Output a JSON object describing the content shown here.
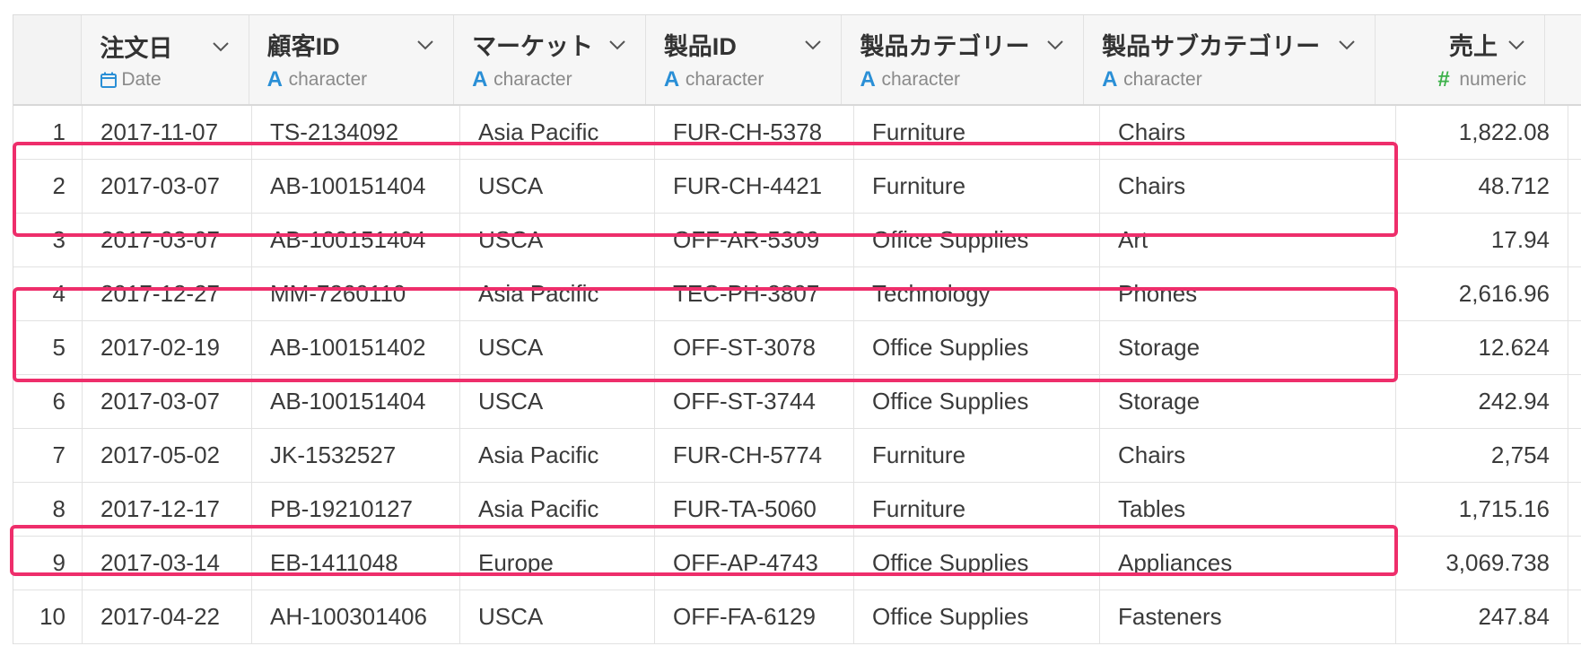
{
  "columns": [
    {
      "name": "注文日",
      "type": "Date",
      "type_icon": "calendar-icon"
    },
    {
      "name": "顧客ID",
      "type": "character",
      "type_icon": "A"
    },
    {
      "name": "マーケット",
      "type": "character",
      "type_icon": "A"
    },
    {
      "name": "製品ID",
      "type": "character",
      "type_icon": "A"
    },
    {
      "name": "製品カテゴリー",
      "type": "character",
      "type_icon": "A"
    },
    {
      "name": "製品サブカテゴリー",
      "type": "character",
      "type_icon": "A"
    },
    {
      "name": "売上",
      "type": "numeric",
      "type_icon": "#"
    }
  ],
  "rows": [
    [
      "1",
      "2017-11-07",
      "TS-2134092",
      "Asia Pacific",
      "FUR-CH-5378",
      "Furniture",
      "Chairs",
      "1,822.08"
    ],
    [
      "2",
      "2017-03-07",
      "AB-100151404",
      "USCA",
      "FUR-CH-4421",
      "Furniture",
      "Chairs",
      "48.712"
    ],
    [
      "3",
      "2017-03-07",
      "AB-100151404",
      "USCA",
      "OFF-AR-5309",
      "Office Supplies",
      "Art",
      "17.94"
    ],
    [
      "4",
      "2017-12-27",
      "MM-7260110",
      "Asia Pacific",
      "TEC-PH-3807",
      "Technology",
      "Phones",
      "2,616.96"
    ],
    [
      "5",
      "2017-02-19",
      "AB-100151402",
      "USCA",
      "OFF-ST-3078",
      "Office Supplies",
      "Storage",
      "12.624"
    ],
    [
      "6",
      "2017-03-07",
      "AB-100151404",
      "USCA",
      "OFF-ST-3744",
      "Office Supplies",
      "Storage",
      "242.94"
    ],
    [
      "7",
      "2017-05-02",
      "JK-1532527",
      "Asia Pacific",
      "FUR-CH-5774",
      "Furniture",
      "Chairs",
      "2,754"
    ],
    [
      "8",
      "2017-12-17",
      "PB-19210127",
      "Asia Pacific",
      "FUR-TA-5060",
      "Furniture",
      "Tables",
      "1,715.16"
    ],
    [
      "9",
      "2017-03-14",
      "EB-1411048",
      "Europe",
      "OFF-AP-4743",
      "Office Supplies",
      "Appliances",
      "3,069.738"
    ],
    [
      "10",
      "2017-04-22",
      "AH-100301406",
      "USCA",
      "OFF-FA-6129",
      "Office Supplies",
      "Fasteners",
      "247.84"
    ]
  ],
  "colors": {
    "highlight": "#ee2e6b",
    "type_character": "#2a8fd6",
    "type_numeric": "#3cb14a",
    "type_date": "#2a8fd6"
  }
}
